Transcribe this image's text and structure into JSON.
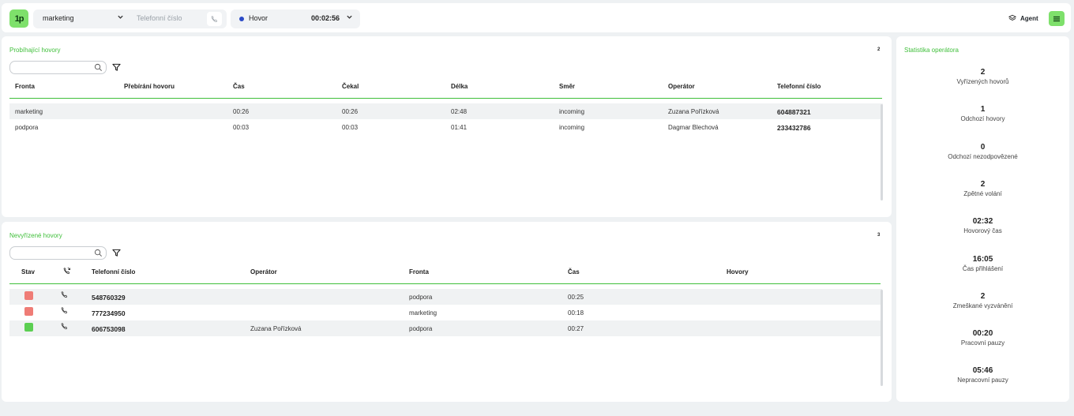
{
  "topbar": {
    "logo": "1p",
    "queue": "marketing",
    "phone_placeholder": "Telefonní číslo",
    "status": "Hovor",
    "timer": "00:02:56",
    "role": "Agent",
    "colors": {
      "accent": "#7ee06b",
      "status_dot": "#2b4ac7"
    }
  },
  "ongoing": {
    "title": "Probíhající hovory",
    "count": "2",
    "columns": [
      "Fronta",
      "Přebírání hovoru",
      "Čas",
      "Čekal",
      "Délka",
      "Směr",
      "Operátor",
      "Telefonní číslo"
    ],
    "rows": [
      {
        "fronta": "marketing",
        "prebirani": "",
        "cas": "00:26",
        "cekal": "00:26",
        "delka": "02:48",
        "smer": "incoming",
        "operator": "Zuzana Pořízková",
        "telefon": "604887321"
      },
      {
        "fronta": "podpora",
        "prebirani": "",
        "cas": "00:03",
        "cekal": "00:03",
        "delka": "01:41",
        "smer": "incoming",
        "operator": "Dagmar Blechová",
        "telefon": "233432786"
      }
    ]
  },
  "unresolved": {
    "title": "Nevyřízené hovory",
    "count": "3",
    "columns": [
      "Stav",
      "",
      "Telefonní číslo",
      "Operátor",
      "Fronta",
      "Čas",
      "Hovory"
    ],
    "rows": [
      {
        "stav_color": "#ef7c76",
        "telefon": "548760329",
        "operator": "",
        "fronta": "podpora",
        "cas": "00:25",
        "hovory": ""
      },
      {
        "stav_color": "#ef7c76",
        "telefon": "777234950",
        "operator": "",
        "fronta": "marketing",
        "cas": "00:18",
        "hovory": ""
      },
      {
        "stav_color": "#5ccf52",
        "telefon": "606753098",
        "operator": "Zuzana Pořízková",
        "fronta": "podpora",
        "cas": "00:27",
        "hovory": ""
      }
    ]
  },
  "stats": {
    "title": "Statistika operátora",
    "items": [
      {
        "value": "2",
        "label": "Vyřízených hovorů"
      },
      {
        "value": "1",
        "label": "Odchozí hovory"
      },
      {
        "value": "0",
        "label": "Odchozí nezodpovězené"
      },
      {
        "value": "2",
        "label": "Zpětné volání"
      },
      {
        "value": "02:32",
        "label": "Hovorový čas"
      },
      {
        "value": "16:05",
        "label": "Čas přihlášení"
      },
      {
        "value": "2",
        "label": "Zmeškané vyzvánění"
      },
      {
        "value": "00:20",
        "label": "Pracovní pauzy"
      },
      {
        "value": "05:46",
        "label": "Nepracovní pauzy"
      }
    ]
  }
}
